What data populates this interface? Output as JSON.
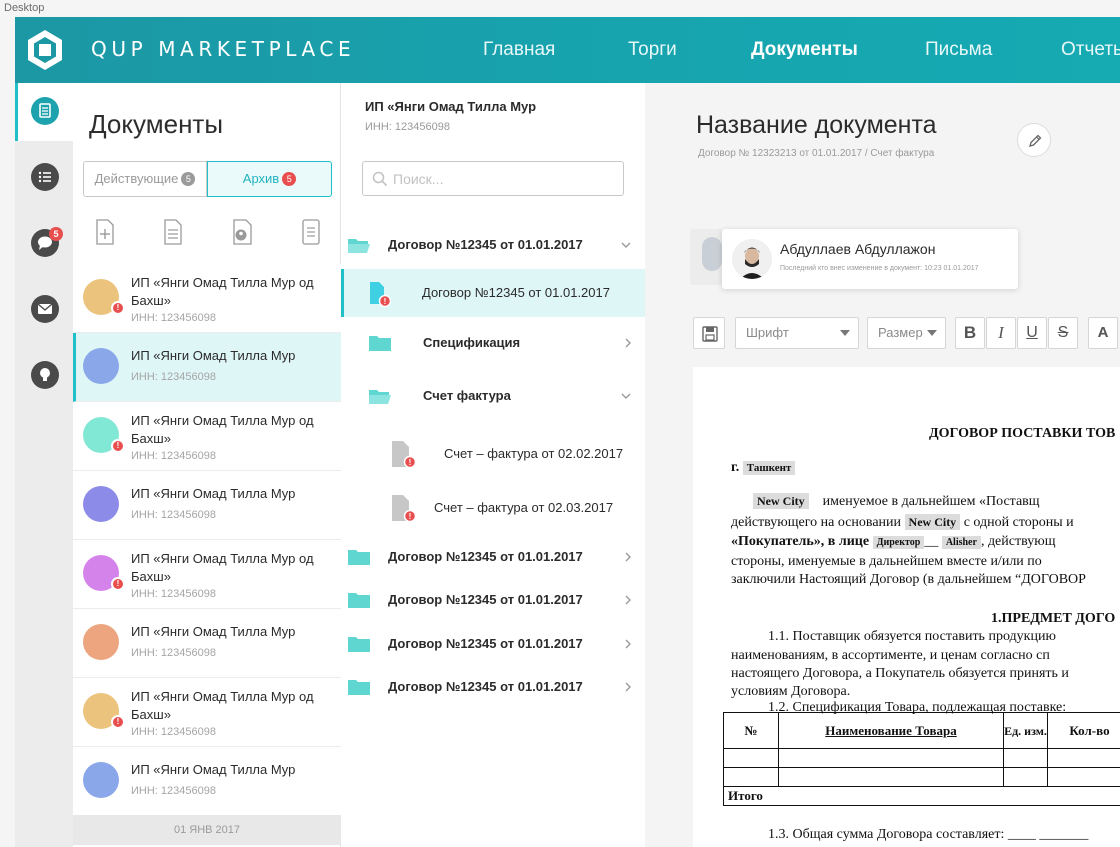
{
  "desktop_label": "Desktop",
  "header": {
    "brand": "QUP MARKETPLACE",
    "nav": [
      {
        "label": "Главная"
      },
      {
        "label": "Торги"
      },
      {
        "label": "Документы"
      },
      {
        "label": "Письма"
      },
      {
        "label": "Отчеты"
      }
    ],
    "active_nav": "Документы"
  },
  "rail": {
    "items": [
      {
        "icon": "documents-icon"
      },
      {
        "icon": "list-icon"
      },
      {
        "icon": "chat-icon",
        "badge": "5"
      },
      {
        "icon": "mail-icon"
      },
      {
        "icon": "lightbulb-icon"
      }
    ]
  },
  "documents_panel": {
    "title": "Документы",
    "tabs": [
      {
        "label": "Действующие",
        "count": "5"
      },
      {
        "label": "Архив",
        "count": "5"
      }
    ],
    "tools": [
      "add-document-icon",
      "document-icon",
      "user-document-icon",
      "list-document-icon"
    ],
    "items": [
      {
        "name": "ИП «Янги Омад Тилла Мур од Бахш»",
        "inn": "ИНН: 123456098",
        "color": "#ebc37c",
        "alert": true
      },
      {
        "name": "ИП «Янги Омад Тилла Мур",
        "inn": "ИНН: 123456098",
        "color": "#8aa7ea",
        "alert": false,
        "selected": true
      },
      {
        "name": "ИП «Янги Омад Тилла Мур од Бахш»",
        "inn": "ИНН: 123456098",
        "color": "#82e8d6",
        "alert": true
      },
      {
        "name": "ИП «Янги Омад Тилла Мур",
        "inn": "ИНН: 123456098",
        "color": "#8c8ce8",
        "alert": false
      },
      {
        "name": "ИП «Янги Омад Тилла Мур од Бахш»",
        "inn": "ИНН: 123456098",
        "color": "#d483ea",
        "alert": true
      },
      {
        "name": "ИП «Янги Омад Тилла Мур",
        "inn": "ИНН: 123456098",
        "color": "#eca57f",
        "alert": false
      },
      {
        "name": "ИП «Янги Омад Тилла Мур од Бахш»",
        "inn": "ИНН: 123456098",
        "color": "#ebc37c",
        "alert": true
      },
      {
        "name": "ИП «Янги Омад Тилла Мур",
        "inn": "ИНН: 123456098",
        "color": "#8aa7ea",
        "alert": false
      }
    ],
    "date_divider": "01 ЯНВ 2017"
  },
  "tree": {
    "company": "ИП «Янги Омад Тилла Мур",
    "inn": "ИНН: 123456098",
    "search_placeholder": "Поиск...",
    "rows": [
      {
        "label": "Договор №12345 от 01.01.2017",
        "type": "folder-open",
        "chevron": "down",
        "bold": true
      },
      {
        "label": "Договор №12345 от 01.01.2017",
        "type": "file-alert",
        "selected": true
      },
      {
        "label": "Спецификация",
        "type": "folder",
        "chevron": "right",
        "bold": true
      },
      {
        "label": "Счет фактура",
        "type": "folder-open",
        "chevron": "down",
        "bold": true
      },
      {
        "label": "Счет – фактура от 02.02.2017",
        "type": "file-gray"
      },
      {
        "label": "Счет – фактура от 02.03.2017",
        "type": "file-gray"
      },
      {
        "label": "Договор №12345 от 01.01.2017",
        "type": "folder",
        "chevron": "right",
        "bold": true
      },
      {
        "label": "Договор №12345 от 01.01.2017",
        "type": "folder",
        "chevron": "right",
        "bold": true
      },
      {
        "label": "Договор №12345 от 01.01.2017",
        "type": "folder",
        "chevron": "right",
        "bold": true
      },
      {
        "label": "Договор №12345 от 01.01.2017",
        "type": "folder",
        "chevron": "right",
        "bold": true
      }
    ]
  },
  "editor": {
    "title": "Название документа",
    "subtitle": "Договор № 12323213 от 01.01.2017 / Счет фактура",
    "history": {
      "name": "Абдуллаев Абдуллажон",
      "note": "Последний кто внес изменение в документ:",
      "time": "10:23  01.01.2017"
    },
    "toolbar": {
      "font_placeholder": "Шрифт",
      "size_placeholder": "Размер",
      "bold": "B",
      "italic": "I",
      "underline": "U",
      "strike": "S",
      "more": "A"
    },
    "paper": {
      "heading": "ДОГОВОР ПОСТАВКИ ТОВ",
      "city_prefix": "г.",
      "city": "Ташкент",
      "field1": "New City",
      "line1": "именуемое  в  дальнейшем  «Поставщ",
      "line2a": "действующего на основании",
      "field2": "New City",
      "line2b": "с одной стороны и",
      "line3a": "«Покупатель»,  в  лице",
      "field3": "Директор",
      "field4": "Alisher",
      "line3b": ",  действующ",
      "line4": "стороны,  именуемые  в  дальнейшем  вместе  и/или  по",
      "line5": "заключили Настоящий Договор (в дальнейшем “ДОГОВОР",
      "section1": "1.ПРЕДМЕТ ДОГО",
      "p11a": "1.1.  Поставщик  обязуется  поставить  продукцию",
      "p11b": "наименованиям,  в  ассортименте,  и  ценам  согласно  сп",
      "p11c": "настоящего Договора, а Покупатель обязуется принять и",
      "p11d": "условиям Договора.",
      "p12": "1.2.  Спецификация Товара, подлежащая поставке:",
      "table_headers": [
        "№",
        "Наименование  Товара",
        "Ед. изм.",
        "Кол-во"
      ],
      "total": "Итого",
      "p13": "1.3. Общая сумма Договора составляет: ____ _______"
    }
  },
  "colors": {
    "accent": "#21c0c8",
    "header": "#17a3ae",
    "alert": "#e84e4e",
    "folder": "#5fd6cf"
  }
}
